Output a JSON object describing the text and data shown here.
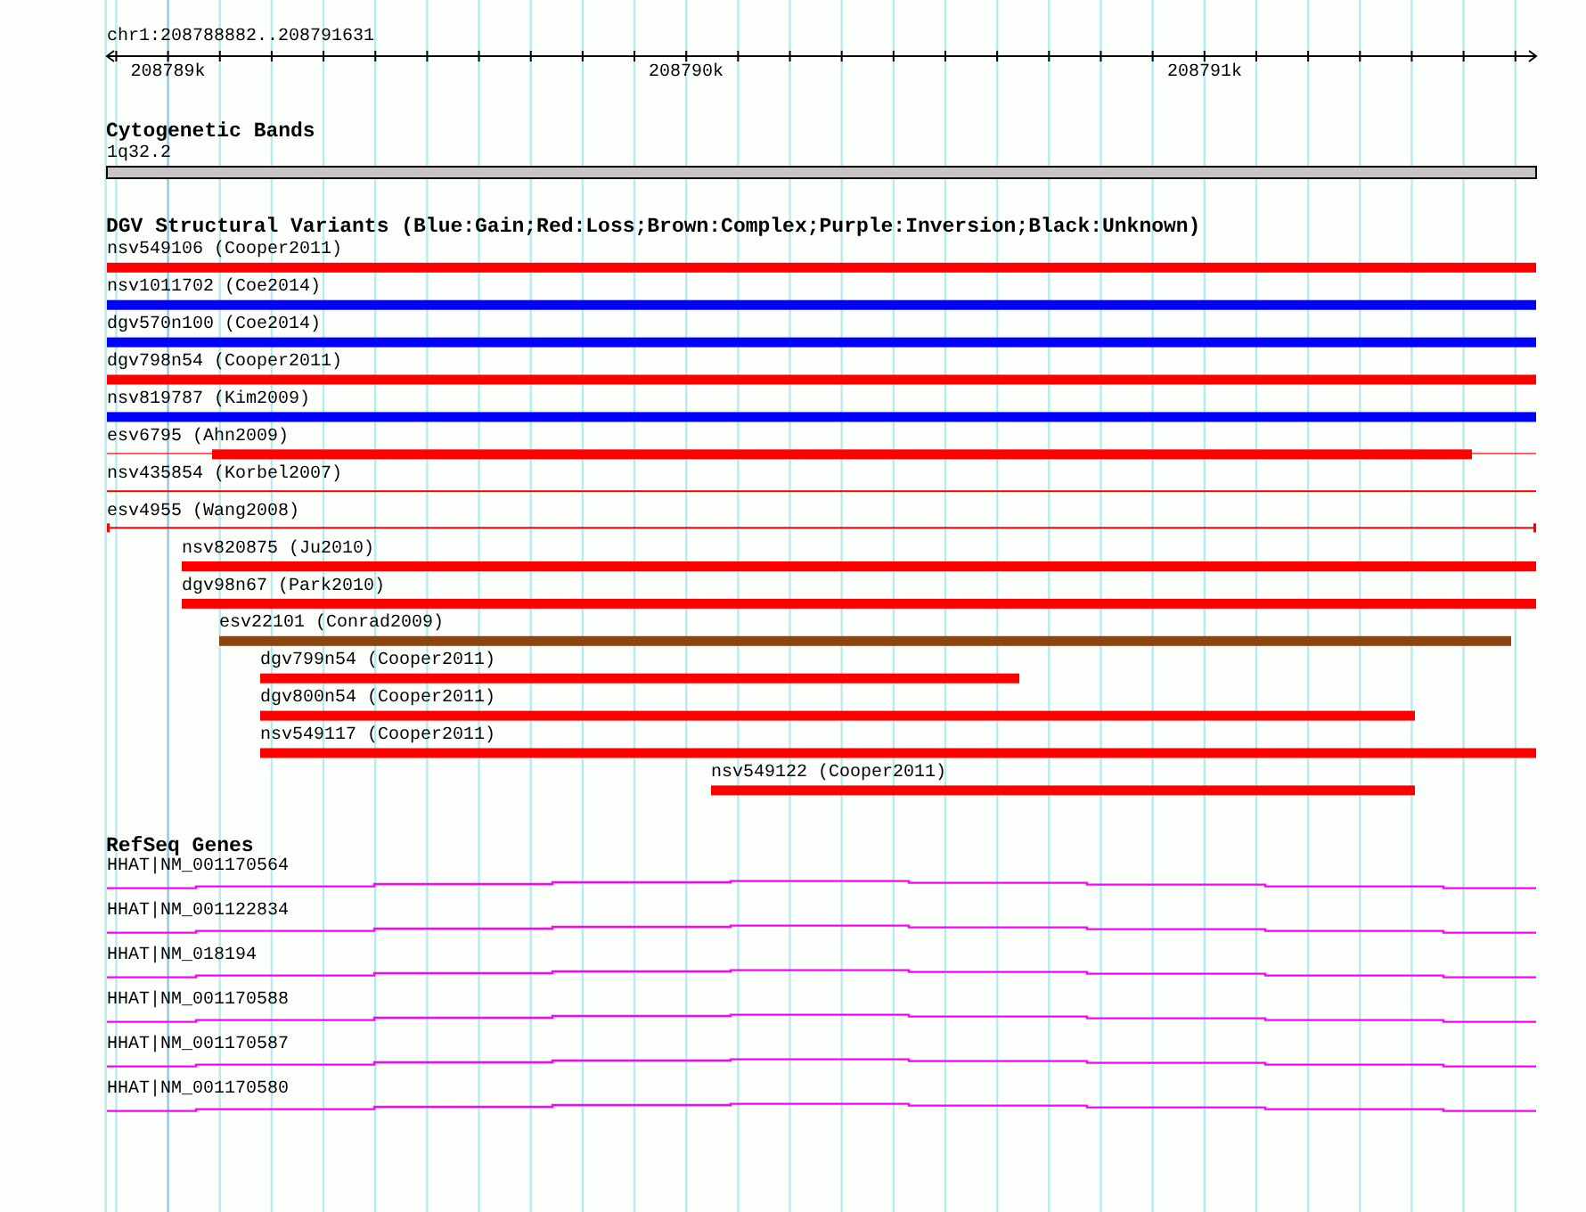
{
  "location": "chr1:208788882..208791631",
  "ruler": {
    "ticks": [
      "208789k",
      "208790k",
      "208791k"
    ]
  },
  "tracks": [
    {
      "kind": "bands",
      "title": "Cytogenetic Bands",
      "features": [
        {
          "label": "1q32.2"
        }
      ]
    },
    {
      "kind": "variants",
      "title": "DGV Structural Variants (Blue:Gain;Red:Loss;Brown:Complex;Purple:Inversion;Black:Unknown)",
      "features": [
        {
          "label": "nsv549106 (Cooper2011)",
          "color": "#ff0000",
          "kind": "bar"
        },
        {
          "label": "nsv1011702 (Coe2014)",
          "color": "#0000ff",
          "kind": "bar"
        },
        {
          "label": "dgv570n100 (Coe2014)",
          "color": "#0000ff",
          "kind": "bar"
        },
        {
          "label": "dgv798n54 (Cooper2011)",
          "color": "#ff0000",
          "kind": "bar"
        },
        {
          "label": "nsv819787 (Kim2009)",
          "color": "#0000ff",
          "kind": "bar"
        },
        {
          "label": "esv6795 (Ahn2009)",
          "color": "#ff0000",
          "kind": "partial"
        },
        {
          "label": "nsv435854 (Korbel2007)",
          "color": "#ff0000",
          "kind": "line"
        },
        {
          "label": "esv4955 (Wang2008)",
          "color": "#ff0000",
          "kind": "span"
        },
        {
          "label": "nsv820875 (Ju2010)",
          "color": "#ff0000",
          "kind": "bar"
        },
        {
          "label": "dgv98n67 (Park2010)",
          "color": "#ff0000",
          "kind": "bar"
        },
        {
          "label": "esv22101 (Conrad2009)",
          "color": "#8b4513",
          "kind": "bar"
        },
        {
          "label": "dgv799n54 (Cooper2011)",
          "color": "#ff0000",
          "kind": "bar"
        },
        {
          "label": "dgv800n54 (Cooper2011)",
          "color": "#ff0000",
          "kind": "bar"
        },
        {
          "label": "nsv549117 (Cooper2011)",
          "color": "#ff0000",
          "kind": "bar"
        },
        {
          "label": "nsv549122 (Cooper2011)",
          "color": "#ff0000",
          "kind": "bar"
        }
      ]
    },
    {
      "kind": "genes",
      "title": "RefSeq Genes",
      "features": [
        {
          "label": "HHAT|NM_001170564"
        },
        {
          "label": "HHAT|NM_001122834"
        },
        {
          "label": "HHAT|NM_018194"
        },
        {
          "label": "HHAT|NM_001170588"
        },
        {
          "label": "HHAT|NM_001170587"
        },
        {
          "label": "HHAT|NM_001170580"
        }
      ]
    }
  ]
}
